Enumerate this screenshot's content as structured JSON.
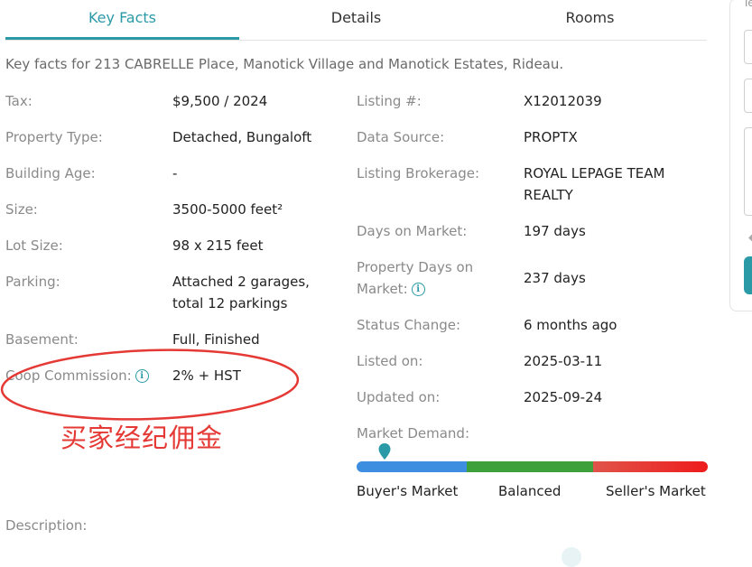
{
  "tabs": [
    {
      "label": "Key Facts",
      "active": true
    },
    {
      "label": "Details",
      "active": false
    },
    {
      "label": "Rooms",
      "active": false
    }
  ],
  "intro": "Key facts for 213 CABRELLE Place, Manotick Village and Manotick Estates, Rideau.",
  "left_facts": [
    {
      "label": "Tax:",
      "value": "$9,500 / 2024"
    },
    {
      "label": "Property Type:",
      "value": "Detached, Bungaloft"
    },
    {
      "label": "Building Age:",
      "value": "-"
    },
    {
      "label": "Size:",
      "value": "3500-5000 feet²"
    },
    {
      "label": "Lot Size:",
      "value": "98 x 215 feet"
    },
    {
      "label": "Parking:",
      "value_line1": "Attached 2 garages,",
      "value_line2": "total 12 parkings"
    },
    {
      "label": "Basement:",
      "value": "Full, Finished"
    },
    {
      "label": "Coop Commission:",
      "value": "2% + HST"
    }
  ],
  "right_facts": [
    {
      "label": "Listing #:",
      "value": "X12012039"
    },
    {
      "label": "Data Source:",
      "value": "PROPTX"
    },
    {
      "label": "Listing Brokerage:",
      "value_line1": "ROYAL LEPAGE TEAM",
      "value_line2": "REALTY"
    },
    {
      "label": "Days on Market:",
      "value": "197 days"
    },
    {
      "label_line1": "Property Days on",
      "label_line2": "Market:",
      "value": "237 days"
    },
    {
      "label": "Status Change:",
      "value": "6 months ago"
    },
    {
      "label": "Listed on:",
      "value": "2025-03-11"
    },
    {
      "label": "Updated on:",
      "value": "2025-09-24"
    }
  ],
  "market_demand": {
    "label": "Market Demand:",
    "scale": [
      "Buyer's Market",
      "Balanced",
      "Seller's Market"
    ],
    "marker_position": 0.08,
    "colors": {
      "buyer": "#3d8ee0",
      "balanced": "#3ea03a",
      "seller": "#ee1c1c"
    }
  },
  "annotation": "买家经纪佣金",
  "description_label": "Description:",
  "side_panel_text": "Te",
  "icons": {
    "info": "info-icon",
    "marker": "map-pin-icon"
  },
  "accent_color": "#2a9aa7"
}
